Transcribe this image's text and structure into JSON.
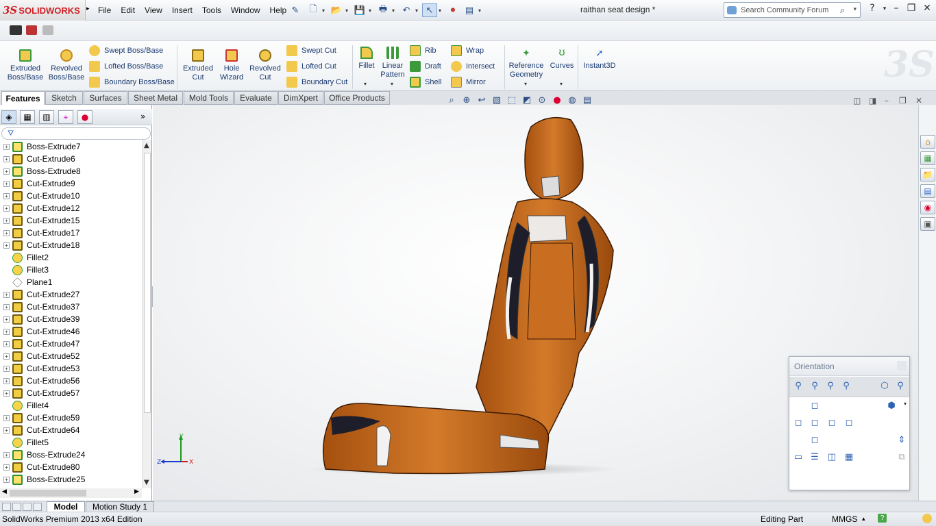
{
  "app": {
    "brand_prefix": "3S",
    "brand_name": "SOLIDWORKS",
    "doc_title": "raithan seat design *"
  },
  "menu": [
    "File",
    "Edit",
    "View",
    "Insert",
    "Tools",
    "Window",
    "Help"
  ],
  "search": {
    "placeholder": "Search Community Forum"
  },
  "command_manager": {
    "extruded_boss": "Extruded\nBoss/Base",
    "revolved_boss": "Revolved\nBoss/Base",
    "swept_boss": "Swept Boss/Base",
    "lofted_boss": "Lofted Boss/Base",
    "boundary_boss": "Boundary Boss/Base",
    "extruded_cut": "Extruded\nCut",
    "hole_wizard": "Hole\nWizard",
    "revolved_cut": "Revolved\nCut",
    "swept_cut": "Swept Cut",
    "lofted_cut": "Lofted Cut",
    "boundary_cut": "Boundary Cut",
    "fillet": "Fillet",
    "linear_pattern": "Linear\nPattern",
    "rib": "Rib",
    "draft": "Draft",
    "shell": "Shell",
    "wrap": "Wrap",
    "intersect": "Intersect",
    "mirror": "Mirror",
    "reference_geometry": "Reference\nGeometry",
    "curves": "Curves",
    "instant3d": "Instant3D"
  },
  "tabs": [
    "Features",
    "Sketch",
    "Surfaces",
    "Sheet Metal",
    "Mold Tools",
    "Evaluate",
    "DimXpert",
    "Office Products"
  ],
  "tree": [
    {
      "label": "Boss-Extrude7",
      "type": "boss",
      "expandable": true
    },
    {
      "label": "Cut-Extrude6",
      "type": "cut",
      "expandable": true
    },
    {
      "label": "Boss-Extrude8",
      "type": "boss",
      "expandable": true
    },
    {
      "label": "Cut-Extrude9",
      "type": "cut",
      "expandable": true
    },
    {
      "label": "Cut-Extrude10",
      "type": "cut",
      "expandable": true
    },
    {
      "label": "Cut-Extrude12",
      "type": "cut",
      "expandable": true
    },
    {
      "label": "Cut-Extrude15",
      "type": "cut",
      "expandable": true
    },
    {
      "label": "Cut-Extrude17",
      "type": "cut",
      "expandable": true
    },
    {
      "label": "Cut-Extrude18",
      "type": "cut",
      "expandable": true
    },
    {
      "label": "Fillet2",
      "type": "fillet",
      "expandable": false
    },
    {
      "label": "Fillet3",
      "type": "fillet",
      "expandable": false
    },
    {
      "label": "Plane1",
      "type": "plane",
      "expandable": false
    },
    {
      "label": "Cut-Extrude27",
      "type": "cut",
      "expandable": true
    },
    {
      "label": "Cut-Extrude37",
      "type": "cut",
      "expandable": true
    },
    {
      "label": "Cut-Extrude39",
      "type": "cut",
      "expandable": true
    },
    {
      "label": "Cut-Extrude46",
      "type": "cut",
      "expandable": true
    },
    {
      "label": "Cut-Extrude47",
      "type": "cut",
      "expandable": true
    },
    {
      "label": "Cut-Extrude52",
      "type": "cut",
      "expandable": true
    },
    {
      "label": "Cut-Extrude53",
      "type": "cut",
      "expandable": true
    },
    {
      "label": "Cut-Extrude56",
      "type": "cut",
      "expandable": true
    },
    {
      "label": "Cut-Extrude57",
      "type": "cut",
      "expandable": true
    },
    {
      "label": "Fillet4",
      "type": "fillet",
      "expandable": false
    },
    {
      "label": "Cut-Extrude59",
      "type": "cut",
      "expandable": true
    },
    {
      "label": "Cut-Extrude64",
      "type": "cut",
      "expandable": true
    },
    {
      "label": "Fillet5",
      "type": "fillet",
      "expandable": false
    },
    {
      "label": "Boss-Extrude24",
      "type": "boss",
      "expandable": true
    },
    {
      "label": "Cut-Extrude80",
      "type": "cut",
      "expandable": true
    },
    {
      "label": "Boss-Extrude25",
      "type": "boss",
      "expandable": true
    }
  ],
  "orientation": {
    "title": "Orientation"
  },
  "triad": {
    "y": "Y",
    "z": "Z",
    "x": "X"
  },
  "bottom_tabs": [
    "Model",
    "Motion Study 1"
  ],
  "status": {
    "edition": "SolidWorks Premium 2013 x64 Edition",
    "mode": "Editing Part",
    "units": "MMGS",
    "help": "?"
  },
  "colors": {
    "seat": "#c8681a",
    "accent": "#d21f26"
  }
}
